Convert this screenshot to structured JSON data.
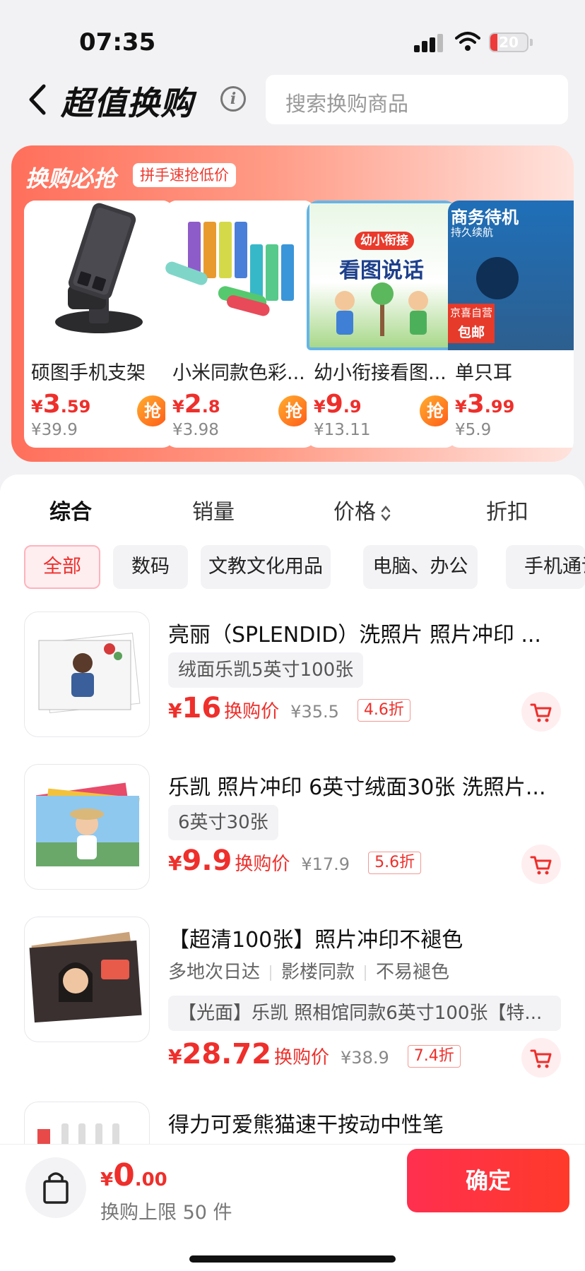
{
  "status_bar": {
    "time": "07:35",
    "battery": "20",
    "battery_level": 0.2
  },
  "header": {
    "title": "超值换购",
    "search_placeholder": "搜索换购商品"
  },
  "promo": {
    "title": "换购必抢",
    "tag": "拼手速抢低价",
    "grab_label": "抢",
    "cards": [
      {
        "name": "硕图手机支架",
        "price_int": "3",
        "price_dec": ".59",
        "orig": "¥39.9"
      },
      {
        "name": "小米同款色彩...",
        "price_int": "2",
        "price_dec": ".8",
        "orig": "¥3.98"
      },
      {
        "name": "幼小衔接看图...",
        "price_int": "9",
        "price_dec": ".9",
        "orig": "¥13.11",
        "img_text": {
          "badge": "幼小衔接",
          "title": "看图说话"
        }
      },
      {
        "name": "单只耳",
        "price_int": "3",
        "price_dec": ".99",
        "orig": "¥5.9",
        "img_text": {
          "top": "商务待机",
          "sub": "持久续航",
          "badge1": "京喜自营",
          "badge2": "包邮"
        }
      }
    ]
  },
  "sort_tabs": [
    "综合",
    "销量",
    "价格",
    "折扣"
  ],
  "chips": [
    "全部",
    "数码",
    "文教文化用品",
    "电脑、办公",
    "手机通讯"
  ],
  "currency": "¥",
  "exchange_label": "换购价",
  "items": [
    {
      "title": "亮丽（SPLENDID）洗照片 照片冲印 ...",
      "spec": "绒面乐凯5英寸100张",
      "price": "16",
      "orig": "¥35.5",
      "discount": "4.6折"
    },
    {
      "title": "乐凯 照片冲印 6英寸绒面30张 洗照片...",
      "spec": "6英寸30张",
      "price": "9.9",
      "orig": "¥17.9",
      "discount": "5.6折"
    },
    {
      "title": "【超清100张】照片冲印不褪色",
      "tags": [
        "多地次日达",
        "影楼同款",
        "不易褪色"
      ],
      "spec": "【光面】乐凯 照相馆同款6英寸100张【特...",
      "price": "28.72",
      "orig": "¥38.9",
      "discount": "7.4折"
    },
    {
      "title": "得力可爱熊猫速干按动中性笔"
    }
  ],
  "footer": {
    "total_int": "0",
    "total_dec": ".00",
    "limit": "换购上限 50 件",
    "confirm": "确定"
  },
  "colors": {
    "accent": "#ee2f2b",
    "banner": "#ff6f5b"
  }
}
